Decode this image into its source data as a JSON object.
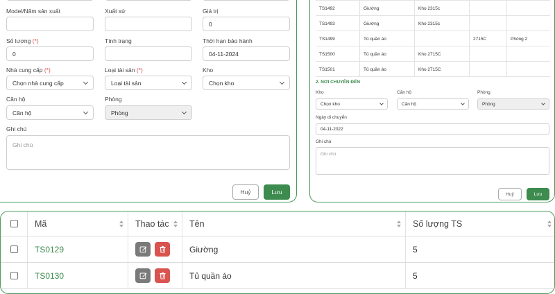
{
  "asset_form": {
    "fields": [
      {
        "label": "Model/Năm sản xuất",
        "value": "",
        "placeholder": "",
        "required": false,
        "type": "text"
      },
      {
        "label": "Xuất xứ",
        "value": "",
        "placeholder": "",
        "required": false,
        "type": "text"
      },
      {
        "label": "Giá trị",
        "value": "0",
        "placeholder": "",
        "required": false,
        "type": "text"
      },
      {
        "label": "Số lượng",
        "value": "0",
        "placeholder": "",
        "required": true,
        "type": "text"
      },
      {
        "label": "Tình trạng",
        "value": "",
        "placeholder": "",
        "required": false,
        "type": "text"
      },
      {
        "label": "Thời hạn bảo hành",
        "value": "04-11-2024",
        "placeholder": "",
        "required": false,
        "type": "text"
      },
      {
        "label": "Nhà cung cấp",
        "value": "Chọn nhà cung cấp",
        "required": true,
        "type": "select"
      },
      {
        "label": "Loại tài sản",
        "value": "Loại tài sản",
        "required": true,
        "type": "select"
      },
      {
        "label": "Kho",
        "value": "Chọn kho",
        "required": false,
        "type": "select"
      },
      {
        "label": "Căn hộ",
        "value": "Căn hộ",
        "required": false,
        "type": "select"
      },
      {
        "label": "Phòng",
        "value": "Phòng",
        "required": false,
        "type": "select",
        "disabled": true
      }
    ],
    "required_mark": "(*)",
    "note_label": "Ghi chú",
    "note_placeholder": "Ghi chú",
    "cancel_label": "Huỷ",
    "save_label": "Lưu"
  },
  "transfer_panel": {
    "rows": [
      [
        "TS1492",
        "Giường",
        "Kho 2315c",
        "",
        ""
      ],
      [
        "TS1493",
        "Giường",
        "Kho 2315c",
        "",
        ""
      ],
      [
        "TS1499",
        "Tủ quần áo",
        "",
        "2715C",
        "Phòng 2"
      ],
      [
        "TS1500",
        "Tủ quần áo",
        "Kho 2715C",
        "",
        ""
      ],
      [
        "TS1501",
        "Tủ quần áo",
        "Kho 2715C",
        "",
        ""
      ]
    ],
    "section_title": "2. NƠI CHUYỂN ĐẾN",
    "kho_label": "Kho",
    "kho_value": "Chọn kho",
    "canho_label": "Căn hộ",
    "canho_value": "Căn hộ",
    "phong_label": "Phòng",
    "phong_value": "Phòng",
    "date_label": "Ngày di chuyển",
    "date_value": "04-11-2022",
    "note_label": "Ghi chú",
    "note_placeholder": "Ghi chú",
    "cancel_label": "Huỷ",
    "save_label": "Lưu"
  },
  "asset_table": {
    "headers": {
      "code": "Mã",
      "actions": "Thao tác",
      "name": "Tên",
      "quantity": "Số lượng TS"
    },
    "rows": [
      {
        "code": "TS0129",
        "name": "Giường",
        "quantity": "5"
      },
      {
        "code": "TS0130",
        "name": "Tủ quần áo",
        "quantity": "5"
      }
    ]
  },
  "colors": {
    "accent": "#3d8b4f",
    "required": "#d9534f",
    "delete": "#d9534f",
    "edit": "#7a7a7a"
  }
}
